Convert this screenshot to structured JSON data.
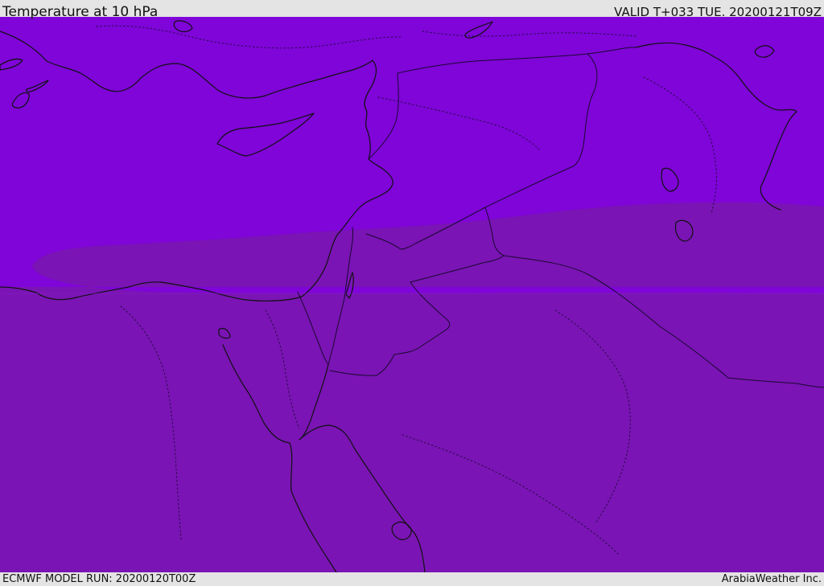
{
  "header": {
    "title": "Temperature at 10 hPa",
    "valid": "VALID T+033 TUE. 20200121T09Z"
  },
  "footer": {
    "model_run": "ECMWF MODEL RUN: 20200120T00Z",
    "credit": "ArabiaWeather Inc."
  },
  "map": {
    "colors": {
      "dark_band": "#7a14b4",
      "bright_band": "#7f05d8",
      "coast": "#111111",
      "borders": "#1a0830"
    }
  }
}
